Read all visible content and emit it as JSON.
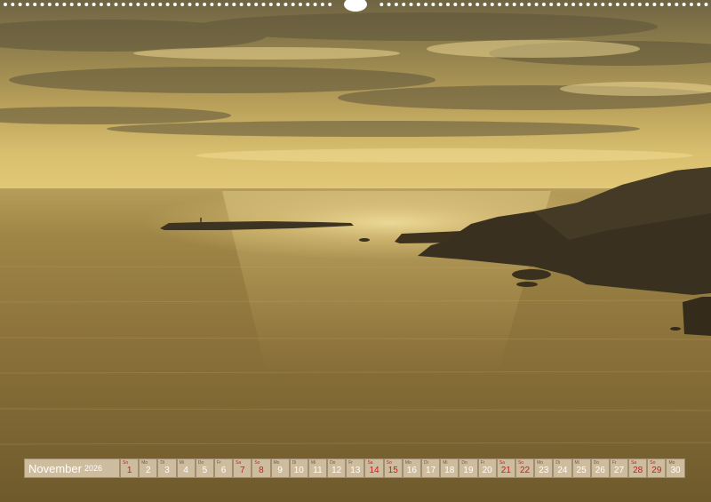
{
  "calendar": {
    "month": "November",
    "year": "2026",
    "days": [
      {
        "wd": "So",
        "n": "1",
        "we": true
      },
      {
        "wd": "Mo",
        "n": "2",
        "we": false
      },
      {
        "wd": "Di",
        "n": "3",
        "we": false
      },
      {
        "wd": "Mi",
        "n": "4",
        "we": false
      },
      {
        "wd": "Do",
        "n": "5",
        "we": false
      },
      {
        "wd": "Fr",
        "n": "6",
        "we": false
      },
      {
        "wd": "Sa",
        "n": "7",
        "we": true
      },
      {
        "wd": "So",
        "n": "8",
        "we": true
      },
      {
        "wd": "Mo",
        "n": "9",
        "we": false
      },
      {
        "wd": "Di",
        "n": "10",
        "we": false
      },
      {
        "wd": "Mi",
        "n": "11",
        "we": false
      },
      {
        "wd": "Do",
        "n": "12",
        "we": false
      },
      {
        "wd": "Fr",
        "n": "13",
        "we": false
      },
      {
        "wd": "Sa",
        "n": "14",
        "we": true
      },
      {
        "wd": "So",
        "n": "15",
        "we": true
      },
      {
        "wd": "Mo",
        "n": "16",
        "we": false
      },
      {
        "wd": "Di",
        "n": "17",
        "we": false
      },
      {
        "wd": "Mi",
        "n": "18",
        "we": false
      },
      {
        "wd": "Do",
        "n": "19",
        "we": false
      },
      {
        "wd": "Fr",
        "n": "20",
        "we": false
      },
      {
        "wd": "Sa",
        "n": "21",
        "we": true
      },
      {
        "wd": "So",
        "n": "22",
        "we": true
      },
      {
        "wd": "Mo",
        "n": "23",
        "we": false
      },
      {
        "wd": "Di",
        "n": "24",
        "we": false
      },
      {
        "wd": "Mi",
        "n": "25",
        "we": false
      },
      {
        "wd": "Do",
        "n": "26",
        "we": false
      },
      {
        "wd": "Fr",
        "n": "27",
        "we": false
      },
      {
        "wd": "Sa",
        "n": "28",
        "we": true
      },
      {
        "wd": "So",
        "n": "29",
        "we": true
      },
      {
        "wd": "Mo",
        "n": "30",
        "we": false
      }
    ]
  }
}
